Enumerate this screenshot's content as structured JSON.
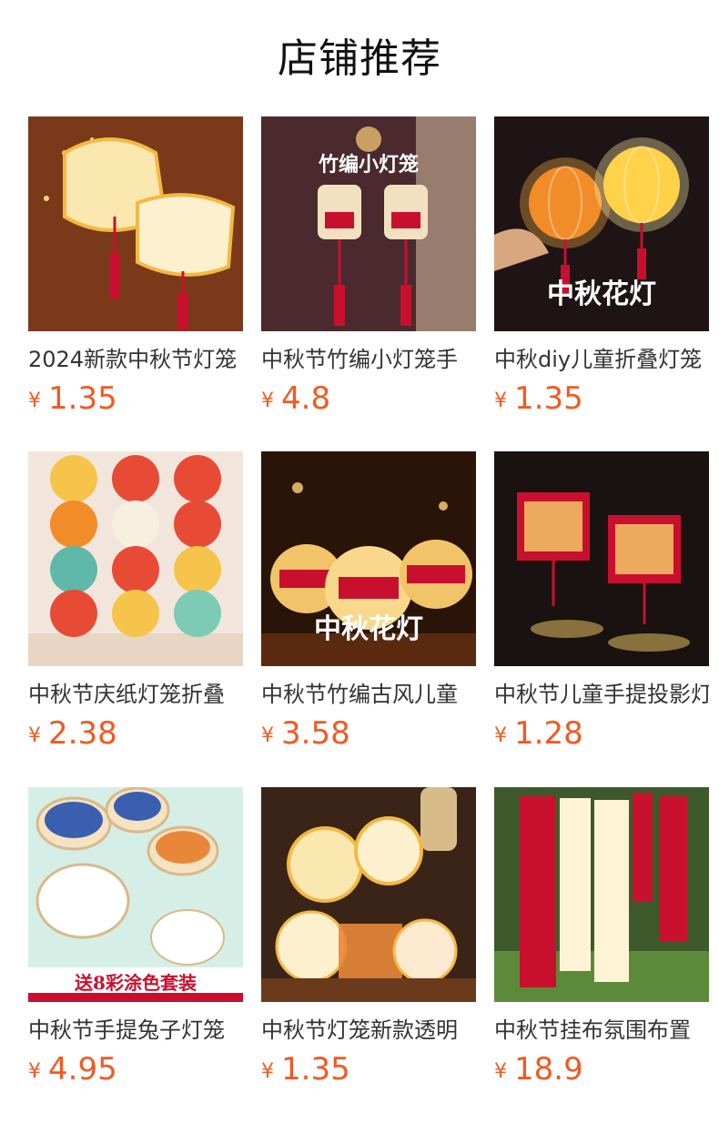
{
  "title": "店铺推荐",
  "currency": "¥",
  "products": [
    {
      "name": "2024新款中秋节灯笼",
      "price": "1.35",
      "icon": "rabbit-lantern-image",
      "bg": "#7a3a1a"
    },
    {
      "name": "中秋节竹编小灯笼手",
      "price": "4.8",
      "icon": "lion-lantern-image",
      "bg": "#4a2a2e",
      "overlay": "竹编小灯笼"
    },
    {
      "name": "中秋diy儿童折叠灯笼",
      "price": "1.35",
      "icon": "paper-lantern-image",
      "bg": "#1e1416",
      "overlay": "中秋花灯"
    },
    {
      "name": "中秋节庆纸灯笼折叠",
      "price": "2.38",
      "icon": "paper-lantern-wall-image",
      "bg": "#f2e6dc"
    },
    {
      "name": "中秋节竹编古风儿童",
      "price": "3.58",
      "icon": "bamboo-lantern-image",
      "bg": "#2a1408",
      "overlay": "中秋花灯"
    },
    {
      "name": "中秋节儿童手提投影灯",
      "price": "1.28",
      "icon": "projection-lantern-image",
      "bg": "#1a1210"
    },
    {
      "name": "中秋节手提兔子灯笼",
      "price": "4.95",
      "icon": "diy-painting-lantern-image",
      "bg": "#d6efe6",
      "overlay": "送8彩涂色套装"
    },
    {
      "name": "中秋节灯笼新款透明",
      "price": "1.35",
      "icon": "transparent-lantern-image",
      "bg": "#3a2418"
    },
    {
      "name": "中秋节挂布氛围布置",
      "price": "18.9",
      "icon": "hanging-banner-image",
      "bg": "#3e5a2c"
    }
  ]
}
